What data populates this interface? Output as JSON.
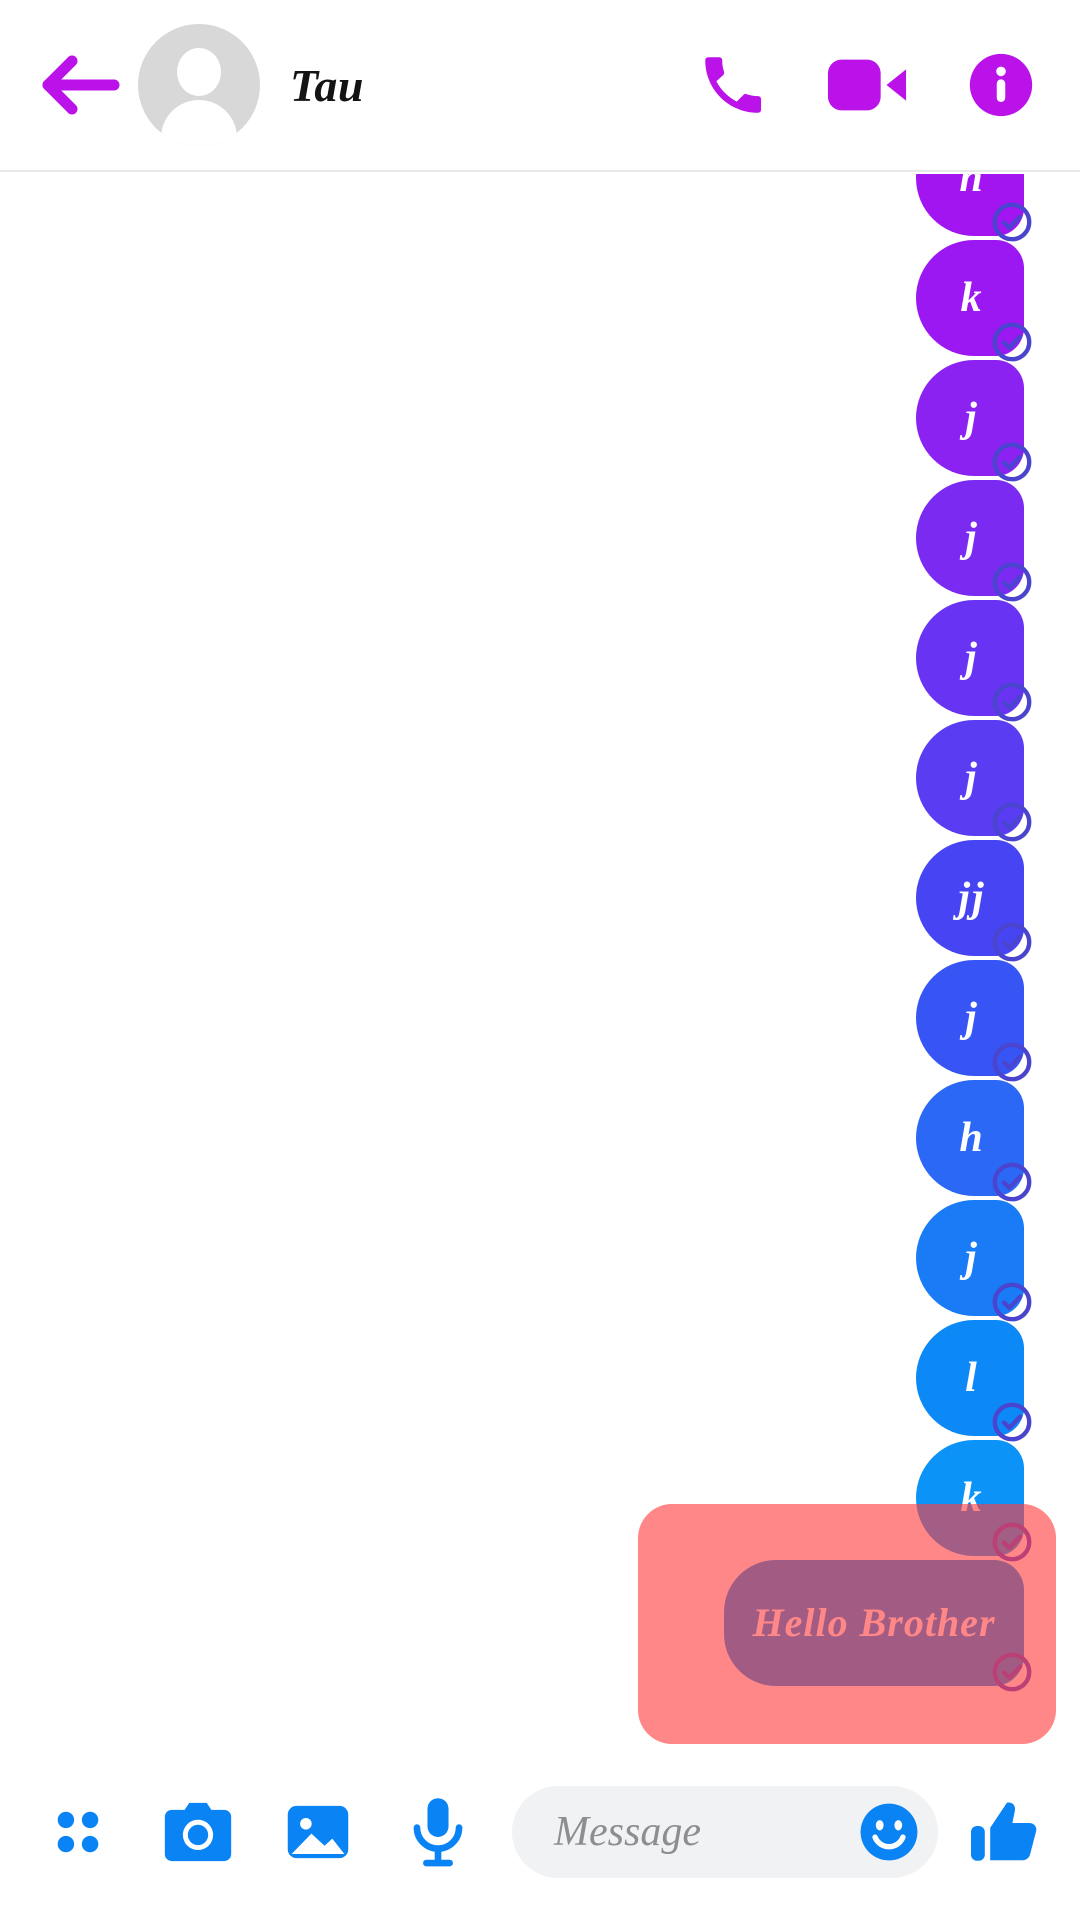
{
  "header": {
    "back_icon": "back-arrow-icon",
    "avatar_icon": "default-person-avatar",
    "peer_name": "Tau",
    "call_icon": "phone-call-icon",
    "video_icon": "video-camera-icon",
    "info_icon": "info-circle-icon",
    "accent_color": "#bb12ea"
  },
  "thread": {
    "status_icon": "check-circle-icon",
    "status_color": "#4a44cf",
    "messages": [
      {
        "text": "n",
        "color": "#a214f0",
        "clipped": true
      },
      {
        "text": "k",
        "color": "#9c18f2"
      },
      {
        "text": "j",
        "color": "#8b22f2"
      },
      {
        "text": "j",
        "color": "#7b2af2"
      },
      {
        "text": "j",
        "color": "#6833f3"
      },
      {
        "text": "j",
        "color": "#5a3cf3"
      },
      {
        "text": "jj",
        "color": "#4644f3"
      },
      {
        "text": "j",
        "color": "#3655f4"
      },
      {
        "text": "h",
        "color": "#2a68f5"
      },
      {
        "text": "j",
        "color": "#1a7bf6"
      },
      {
        "text": "l",
        "color": "#0d88f7"
      },
      {
        "text": "k",
        "color": "#0b93f8"
      },
      {
        "text": "Hello Brother",
        "color": "#0c8ef6",
        "highlighted": true
      }
    ],
    "highlight_color": "#ff3e3e"
  },
  "composer": {
    "apps_icon": "apps-grid-icon",
    "camera_icon": "camera-icon",
    "gallery_icon": "image-gallery-icon",
    "mic_icon": "microphone-icon",
    "placeholder": "Message",
    "input_value": "",
    "emoji_icon": "smiley-face-icon",
    "like_icon": "thumbs-up-icon",
    "accent_color": "#0a84f5"
  }
}
